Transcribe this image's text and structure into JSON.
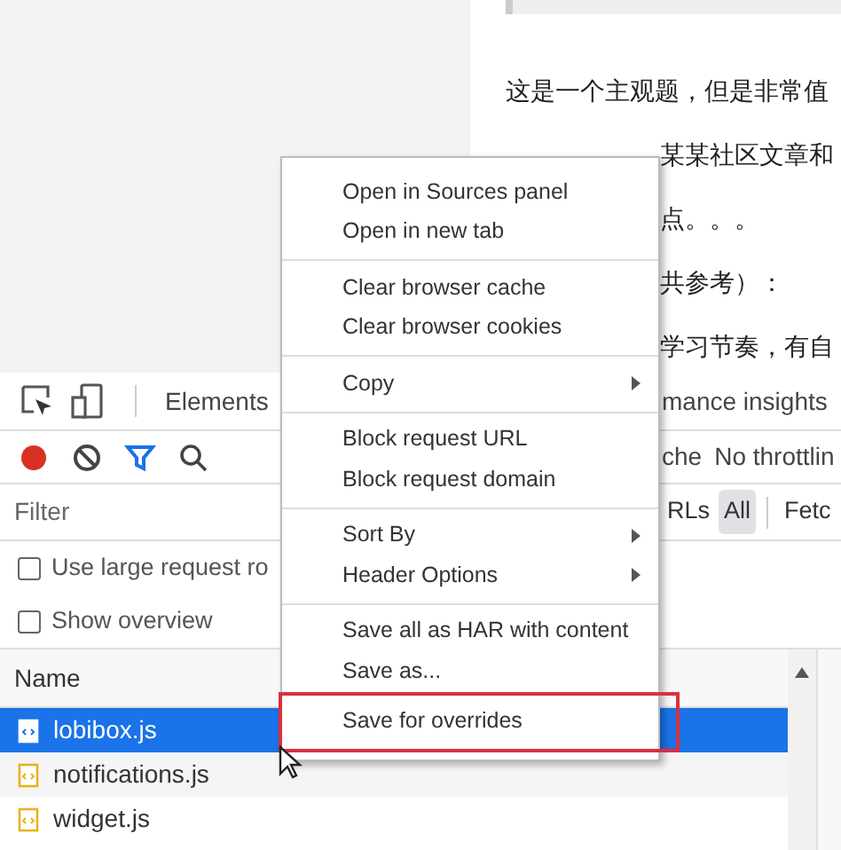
{
  "article": {
    "first_line": "这是一个主观题，但是非常值",
    "fragments": [
      "某某社区文章和",
      "点。。。",
      "共参考）：",
      "学习节奏，有自"
    ]
  },
  "devtools": {
    "tabs": [
      {
        "label": "Elements",
        "selected": false
      },
      {
        "label": "mance insights",
        "selected": false
      }
    ],
    "recording": true,
    "toolbar_texts": [
      "che",
      "No throttlin"
    ],
    "filter": {
      "placeholder": "Filter"
    },
    "type_filters": [
      {
        "label": "RLs",
        "selected": false
      },
      {
        "label": "All",
        "selected": true
      },
      {
        "label": "Fetc",
        "selected": false
      }
    ],
    "options": [
      {
        "label": "Use large request ro",
        "checked": false
      },
      {
        "label": "Show overview",
        "checked": false
      }
    ],
    "table": {
      "columns": [
        "Name"
      ],
      "rows": [
        {
          "name": "lobibox.js",
          "selected": true
        },
        {
          "name": "notifications.js",
          "selected": false
        },
        {
          "name": "widget.js",
          "selected": false
        }
      ]
    }
  },
  "context_menu": {
    "groups": [
      [
        {
          "label": "Open in Sources panel",
          "submenu": false,
          "outlined": false
        },
        {
          "label": "Open in new tab",
          "submenu": false,
          "outlined": false
        }
      ],
      [
        {
          "label": "Clear browser cache",
          "submenu": false,
          "outlined": false
        },
        {
          "label": "Clear browser cookies",
          "submenu": false,
          "outlined": false
        }
      ],
      [
        {
          "label": "Copy",
          "submenu": true,
          "outlined": false
        }
      ],
      [
        {
          "label": "Block request URL",
          "submenu": false,
          "outlined": false
        },
        {
          "label": "Block request domain",
          "submenu": false,
          "outlined": false
        }
      ],
      [
        {
          "label": "Sort By",
          "submenu": true,
          "outlined": false
        },
        {
          "label": "Header Options",
          "submenu": true,
          "outlined": false
        }
      ],
      [
        {
          "label": "Save all as HAR with content",
          "submenu": false,
          "outlined": false
        },
        {
          "label": "Save as...",
          "submenu": false,
          "outlined": false
        },
        {
          "label": "Save for overrides",
          "submenu": false,
          "outlined": true
        }
      ]
    ]
  }
}
